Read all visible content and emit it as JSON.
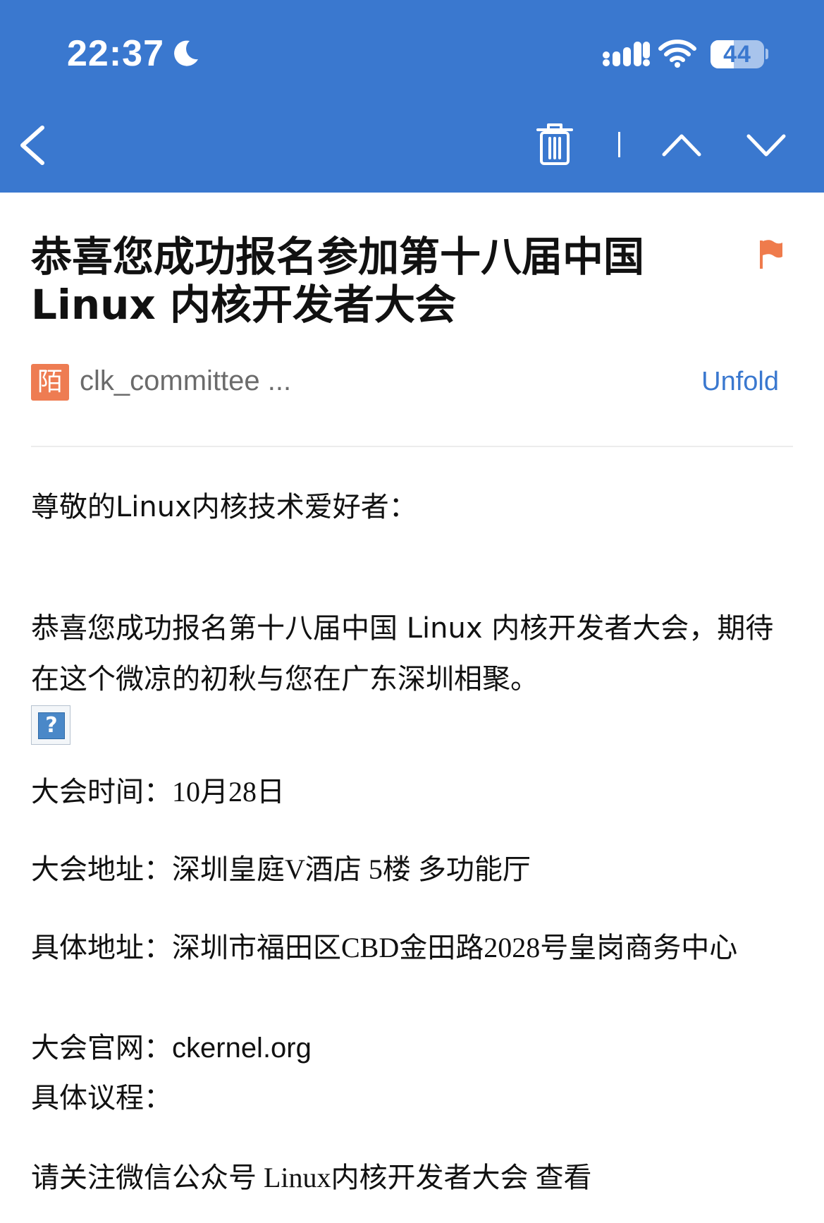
{
  "status_bar": {
    "time": "22:37",
    "battery_level": "44",
    "battery_fraction": 0.44,
    "icons": [
      "moon-icon",
      "signal-icon",
      "wifi-icon",
      "battery-icon"
    ]
  },
  "nav": {
    "icons": [
      "back-chevron-icon",
      "trash-icon",
      "separator",
      "previous-chevron-up-icon",
      "next-chevron-down-icon"
    ]
  },
  "email": {
    "subject": "恭喜您成功报名参加第十八届中国 Linux 内核开发者大会",
    "sender_avatar": "陌",
    "sender": "clk_committee ...",
    "unfold_label": "Unfold",
    "greeting": "尊敬的Linux内核技术爱好者：",
    "paragraph": "恭喜您成功报名第十八届中国 Linux 内核开发者大会，期待在这个微凉的初秋与您在广东深圳相聚。",
    "broken_image_glyph": "?",
    "details": [
      {
        "label": "大会时间：",
        "value": "10月28日"
      },
      {
        "label": "大会地址：",
        "value": "深圳皇庭V酒店 5楼 多功能厅"
      },
      {
        "label": "具体地址：",
        "value": "深圳市福田区CBD金田路2028号皇岗商务中心"
      },
      {
        "label": "大会官网：",
        "value": "ckernel.org"
      },
      {
        "label": "具体议程：",
        "value": ""
      }
    ],
    "footer_line": "请关注微信公众号 Linux内核开发者大会 查看"
  },
  "colors": {
    "header_blue": "#3a78cf",
    "flag_orange": "#ef7b4c",
    "avatar_orange": "#ee7c52",
    "link_blue": "#3a78cf"
  }
}
